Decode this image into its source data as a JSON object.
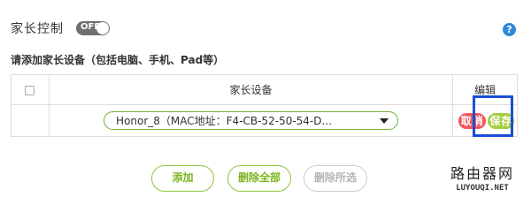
{
  "header": {
    "title": "家长控制",
    "toggle_label": "OFF",
    "help_symbol": "?"
  },
  "hint": "请添加家长设备（包括电脑、手机、Pad等）",
  "table": {
    "columns": [
      "",
      "家长设备",
      "编辑"
    ],
    "rows": [
      {
        "device": "Honor_8（MAC地址：F4-CB-52-50-54-D...",
        "cancel_label": "取消",
        "save_label": "保存"
      }
    ]
  },
  "actions": {
    "add": "添加",
    "delete_all": "删除全部",
    "delete_selected": "删除所选"
  },
  "watermark": {
    "cn": "路由器网",
    "en": "LUYOUQI.NET"
  },
  "colors": {
    "accent_green": "#8dc63f",
    "cancel_red": "#f2575c",
    "highlight_blue": "#1a4ed8",
    "help_blue": "#2f8ad8"
  }
}
